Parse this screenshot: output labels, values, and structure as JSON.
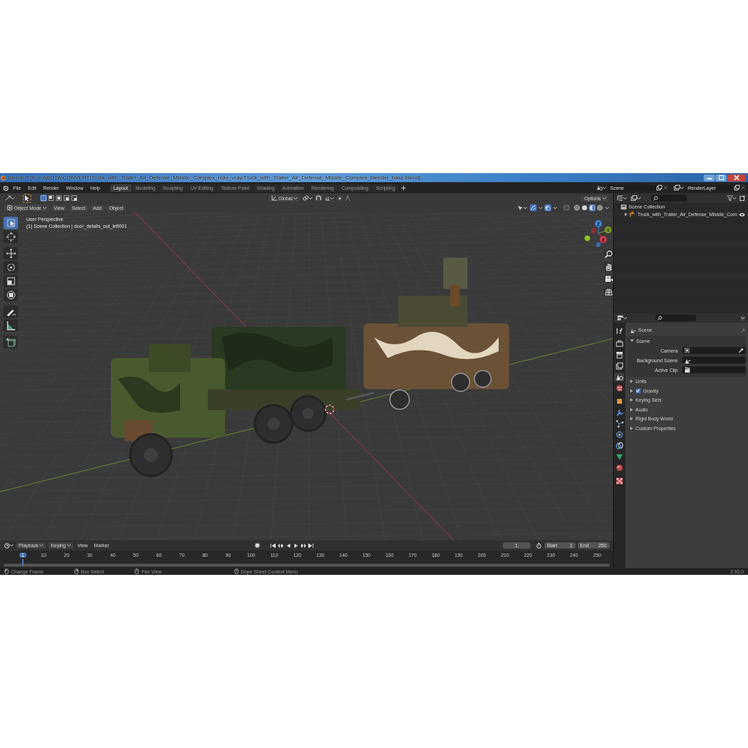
{
  "window": {
    "title": "Blender* [E:\\RABOTA\\CONVERT\\Truck_with_Trailer_Air_Defense_Missile_Complex_max_vray/Truck_with_Trailer_Air_Defense_Missile_Complex_blender_base.blend]"
  },
  "menu": [
    "File",
    "Edit",
    "Render",
    "Window",
    "Help"
  ],
  "workspaces": [
    {
      "label": "Layout",
      "selected": true
    },
    {
      "label": "Modeling",
      "selected": false
    },
    {
      "label": "Sculpting",
      "selected": false
    },
    {
      "label": "UV Editing",
      "selected": false
    },
    {
      "label": "Texture Paint",
      "selected": false
    },
    {
      "label": "Shading",
      "selected": false
    },
    {
      "label": "Animation",
      "selected": false
    },
    {
      "label": "Rendering",
      "selected": false
    },
    {
      "label": "Compositing",
      "selected": false
    },
    {
      "label": "Scripting",
      "selected": false
    }
  ],
  "scene_selector": {
    "value": "Scene"
  },
  "view_layer_selector": {
    "value": "RenderLayer"
  },
  "tool_header": {
    "orientation": "Global",
    "options": "Options"
  },
  "viewport_header": {
    "mode": "Object Mode",
    "menus": [
      "View",
      "Select",
      "Add",
      "Object"
    ]
  },
  "shading_modes": [
    {
      "kind": "wireframe",
      "selected": false
    },
    {
      "kind": "solid",
      "selected": false
    },
    {
      "kind": "material",
      "selected": true
    },
    {
      "kind": "rendered",
      "selected": false
    }
  ],
  "viewport": {
    "view_name": "User Perspective",
    "context": "(1) Scene Collection | door_details_out_left001",
    "gizmo_axes": [
      "Z",
      "Y",
      "X"
    ]
  },
  "toolbar": [
    {
      "kind": "select",
      "selected": true
    },
    {
      "kind": "cursor",
      "selected": false
    },
    {
      "kind": "move",
      "selected": false
    },
    {
      "kind": "rotate",
      "selected": false
    },
    {
      "kind": "scale",
      "selected": false
    },
    {
      "kind": "transform",
      "selected": false
    },
    {
      "kind": "annotate",
      "selected": false
    },
    {
      "kind": "measure",
      "selected": false
    },
    {
      "kind": "add-cube",
      "selected": false
    }
  ],
  "outliner": {
    "items": [
      {
        "label": "Scene Collection",
        "children": [
          {
            "label": "Truck_with_Trailer_Air_Defense_Missile_Com"
          }
        ]
      }
    ]
  },
  "properties": {
    "tabs": [
      {
        "kind": "tool",
        "selected": false
      },
      {
        "kind": "render",
        "selected": false
      },
      {
        "kind": "output",
        "selected": false
      },
      {
        "kind": "view-layer",
        "selected": false
      },
      {
        "kind": "scene",
        "selected": true
      },
      {
        "kind": "world",
        "selected": false
      },
      {
        "kind": "object",
        "selected": false
      },
      {
        "kind": "modifiers",
        "selected": false
      },
      {
        "kind": "particles",
        "selected": false
      },
      {
        "kind": "physics",
        "selected": false
      },
      {
        "kind": "constraints",
        "selected": false
      },
      {
        "kind": "data",
        "selected": false
      },
      {
        "kind": "material",
        "selected": false
      },
      {
        "kind": "texture",
        "selected": false
      }
    ],
    "title": "Scene",
    "panel": "Scene",
    "fields": [
      {
        "label": "Camera"
      },
      {
        "label": "Background Scene"
      },
      {
        "label": "Active Clip"
      }
    ],
    "sections": [
      {
        "label": "Units",
        "kind": "plain"
      },
      {
        "label": "Gravity",
        "kind": "checkbox",
        "checked": true
      },
      {
        "label": "Keying Sets",
        "kind": "plain"
      },
      {
        "label": "Audio",
        "kind": "plain"
      },
      {
        "label": "Rigid Body World",
        "kind": "plain"
      },
      {
        "label": "Custom Properties",
        "kind": "plain"
      }
    ]
  },
  "timeline": {
    "menus": [
      "Playback",
      "Keying",
      "View",
      "Marker"
    ],
    "current_frame": "1",
    "start_label": "Start",
    "start": "1",
    "end_label": "End",
    "end": "250",
    "ruler": [
      "1",
      "10",
      "20",
      "30",
      "40",
      "50",
      "60",
      "70",
      "80",
      "90",
      "100",
      "110",
      "120",
      "130",
      "140",
      "150",
      "160",
      "170",
      "180",
      "190",
      "200",
      "210",
      "220",
      "230",
      "240",
      "250"
    ]
  },
  "status_bar": {
    "hints": [
      "Change Frame",
      "Box Select",
      "Pan View",
      "Dope Sheet Context Menu"
    ],
    "version": "2.92.0"
  }
}
